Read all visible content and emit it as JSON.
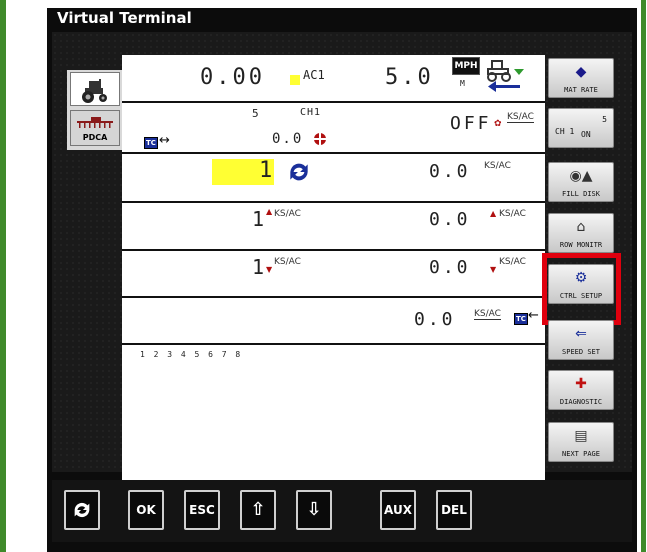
{
  "window": {
    "title": "Virtual Terminal"
  },
  "left_tabs": [
    {
      "name": "tractor",
      "icon": "tractor-icon"
    },
    {
      "name": "pdca",
      "label": "PDCA",
      "icon": "sprayer-icon"
    }
  ],
  "rows": {
    "row1": {
      "rate": "0.00",
      "unit_label": "AC1",
      "speed": "5.0",
      "speed_unit_top": "MPH",
      "speed_unit_bottom": "M"
    },
    "row2": {
      "channel_number": "5",
      "channel_label": "CH1",
      "value": "0.0",
      "status": "OFF",
      "unit": "KS/AC"
    },
    "row3": {
      "count": "1",
      "value": "0.0",
      "unit": "KS/AC"
    },
    "row4": {
      "count": "1",
      "value": "0.0",
      "unit": "KS/AC"
    },
    "row5": {
      "count": "1",
      "value": "0.0",
      "unit": "KS/AC"
    },
    "row6": {
      "value": "0.0",
      "unit": "KS/AC"
    },
    "row7": {
      "sections": "1 2 3 4 5 6 7 8"
    }
  },
  "right_buttons": [
    {
      "label": "MAT RATE",
      "icon": "mat-rate-icon"
    },
    {
      "label": "ON",
      "prefix": "CH 1",
      "sup": "5",
      "icon": ""
    },
    {
      "label": "FILL DISK",
      "icon": "fill-disk-icon"
    },
    {
      "label": "ROW MONITR",
      "icon": "row-monitor-icon"
    },
    {
      "label": "CTRL SETUP",
      "icon": "ctrl-setup-icon"
    },
    {
      "label": "SPEED SET",
      "icon": "speed-set-icon"
    },
    {
      "label": "DIAGNOSTIC",
      "icon": "diagnostic-icon"
    },
    {
      "label": "NEXT PAGE",
      "icon": "next-page-icon"
    }
  ],
  "bottom_buttons": {
    "refresh": "",
    "ok": "OK",
    "esc": "ESC",
    "up": "",
    "down": "",
    "aux": "AUX",
    "del": "DEL"
  },
  "badges": {
    "tc": "TC"
  },
  "colors": {
    "highlight": "#e0000e",
    "frame": "#3f8a2a",
    "accent_blue": "#1a2f9a",
    "yellow": "#ffff33"
  }
}
